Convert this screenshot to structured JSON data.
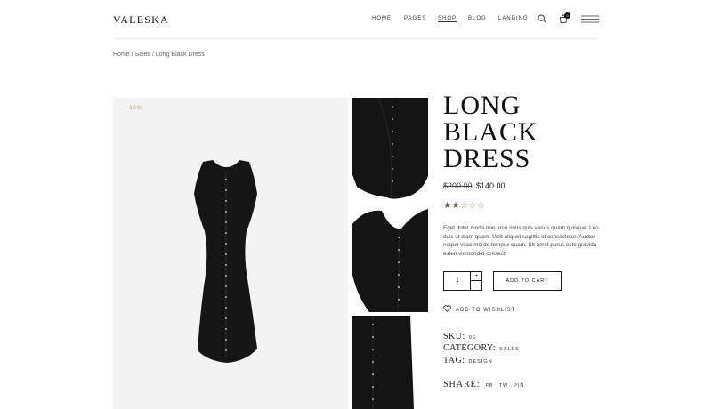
{
  "header": {
    "logo": "VALESKA",
    "nav": [
      "HOME",
      "PAGES",
      "SHOP",
      "BLOG",
      "LANDING"
    ],
    "active_nav": "SHOP",
    "cart_count": "0",
    "icons": [
      "search-icon",
      "cart-icon",
      "menu-icon"
    ]
  },
  "breadcrumb": {
    "home": "Home",
    "sep": " / ",
    "category": "Sales",
    "current": "Long Black Dress"
  },
  "gallery": {
    "badge": "-30%",
    "thumbnail_count": 3
  },
  "product": {
    "title_lines": [
      "LONG",
      "BLACK",
      "DRESS"
    ],
    "price_old": "$200.00",
    "price_new": "$140.00",
    "rating": 2,
    "rating_max": 5,
    "description": "Eget dolor morbi non arcu risus quis varius quam quisque. Leo duis ut diam quam. Velit aliquet sagittis id consectetur. Auctor neque vitae morde tempus quam. Sit amet purus este gravida esten vidmondet consect.",
    "quantity": "1",
    "plus_label": "+",
    "minus_label": "-",
    "add_to_cart": "ADD TO CART",
    "wishlist": "ADD TO WISHLIST",
    "sku_label": "SKU:",
    "sku_value": "05",
    "category_label": "CATEGORY:",
    "category_value": "SALES",
    "tag_label": "TAG:",
    "tag_value": "DESIGN",
    "share_label": "SHARE:",
    "share_links": [
      "FB",
      "TW",
      "PIN"
    ]
  },
  "colors": {
    "accent": "#b9a06d",
    "dress": "#141414",
    "image_bg": "#f3f3f3"
  }
}
